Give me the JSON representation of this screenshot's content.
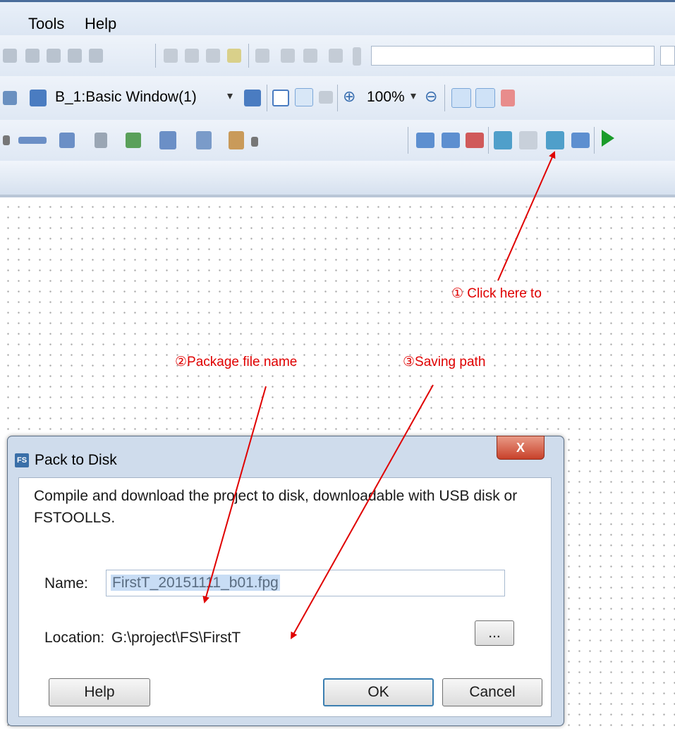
{
  "menu": {
    "items": [
      "Tools",
      "Help"
    ]
  },
  "toolbar": {
    "window_combo": "B_1:Basic Window(1)",
    "zoom": "100%"
  },
  "annotations": {
    "step1": "① Click   here   to",
    "step2": "②Package file name",
    "step3": "③Saving path"
  },
  "dialog": {
    "title": "Pack to Disk",
    "app_badge": "FS",
    "close": "X",
    "description": "Compile and download the project to disk, downloadable with USB disk or FSTOOLLS.",
    "name_label": "Name:",
    "name_value": "FirstT_20151111_b01.fpg",
    "location_label": "Location:",
    "location_value": "G:\\project\\FS\\FirstT",
    "browse_label": "...",
    "help_label": "Help",
    "ok_label": "OK",
    "cancel_label": "Cancel"
  },
  "colors": {
    "annotation": "#e00000",
    "accent": "#3c7fb1"
  }
}
